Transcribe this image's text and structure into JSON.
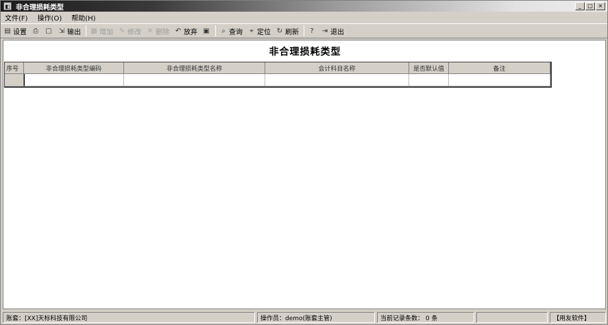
{
  "window": {
    "title": "非合理损耗类型",
    "controls": [
      "_",
      "□",
      "×"
    ]
  },
  "menu": {
    "items": [
      "文件(F)",
      "操作(O)",
      "帮助(H)"
    ]
  },
  "toolbar": {
    "buttons": [
      {
        "label": "设置",
        "icon": "settings-icon",
        "glyph": "▤",
        "enabled": true
      },
      {
        "label": "",
        "icon": "print-icon",
        "glyph": "⎙",
        "enabled": true
      },
      {
        "label": "",
        "icon": "preview-icon",
        "glyph": "▢",
        "enabled": true
      },
      {
        "label": "输出",
        "icon": "export-icon",
        "glyph": "⇲",
        "enabled": true
      },
      {
        "label": "增加",
        "icon": "add-icon",
        "glyph": "▦",
        "enabled": false
      },
      {
        "label": "修改",
        "icon": "edit-icon",
        "glyph": "✎",
        "enabled": false
      },
      {
        "label": "删除",
        "icon": "delete-icon",
        "glyph": "✕",
        "enabled": false
      },
      {
        "label": "放弃",
        "icon": "undo-icon",
        "glyph": "↶",
        "enabled": true
      },
      {
        "label": "",
        "icon": "save-icon",
        "glyph": "▣",
        "enabled": true
      },
      {
        "label": "查询",
        "icon": "query-icon",
        "glyph": "⌕",
        "enabled": true
      },
      {
        "label": "定位",
        "icon": "locate-icon",
        "glyph": "⌖",
        "enabled": true
      },
      {
        "label": "刷新",
        "icon": "refresh-icon",
        "glyph": "↻",
        "enabled": true
      },
      {
        "label": "",
        "icon": "help-icon",
        "glyph": "?",
        "enabled": true
      },
      {
        "label": "退出",
        "icon": "exit-icon",
        "glyph": "⇥",
        "enabled": true
      }
    ]
  },
  "page": {
    "heading": "非合理损耗类型"
  },
  "table": {
    "columns": [
      "序号",
      "非合理损耗类型编码",
      "非合理损耗类型名称",
      "会计科目名称",
      "是否默认值",
      "备注"
    ],
    "rows": [
      [
        "",
        "",
        "",
        "",
        "",
        ""
      ]
    ]
  },
  "status": {
    "account": "账套：[XX]天标科技有限公司",
    "operator": "操作员：demo(账套主管)",
    "record_count": "当前记录条数： 0 条",
    "empty": "",
    "brand": "【用友软件】"
  }
}
